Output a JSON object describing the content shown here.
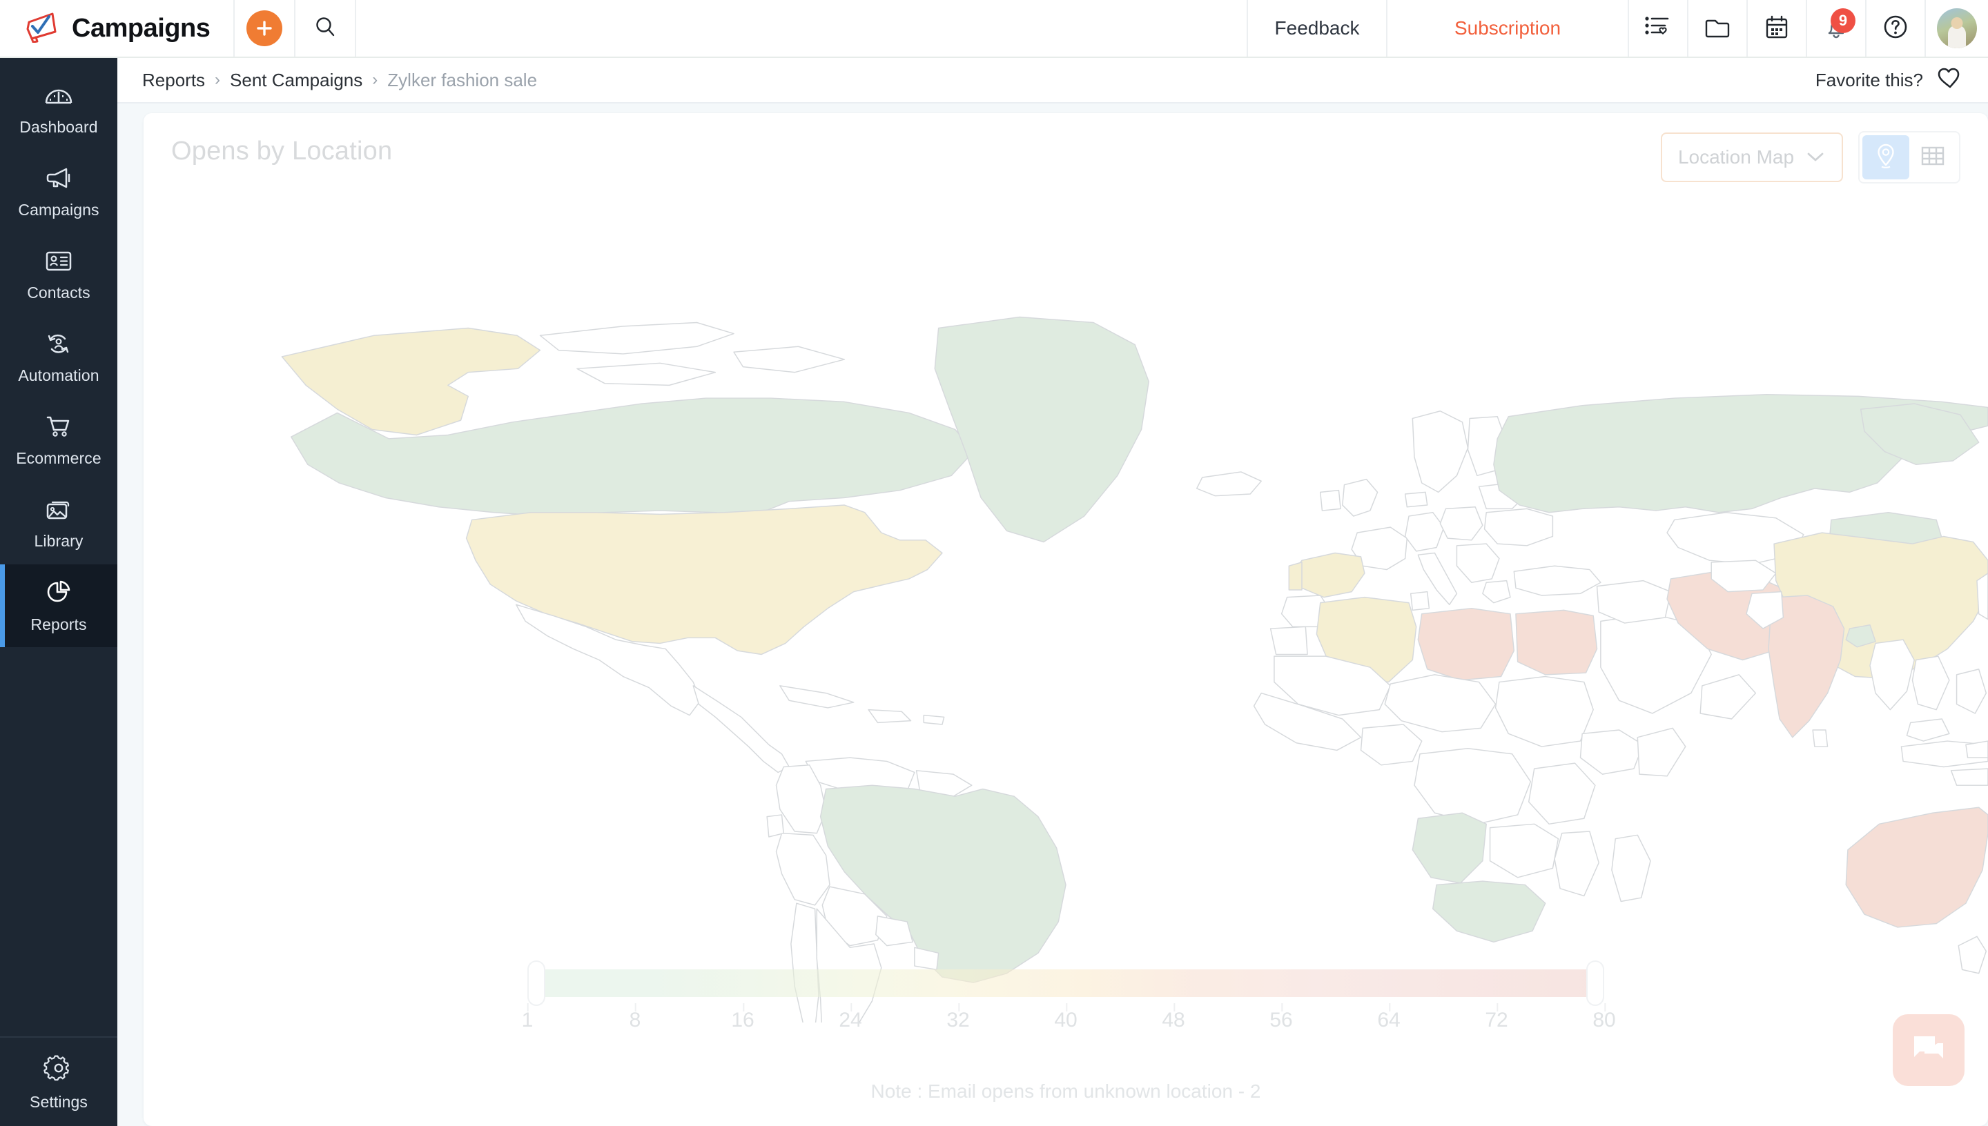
{
  "header": {
    "brand": "Campaigns",
    "logo_icon": "megaphone-logo-icon",
    "create_label": "+",
    "search_icon": "search-icon",
    "feedback_label": "Feedback",
    "subscription_label": "Subscription",
    "icons": [
      {
        "name": "list-heart-icon"
      },
      {
        "name": "folder-icon"
      },
      {
        "name": "calendar-icon"
      },
      {
        "name": "bell-icon",
        "badge": "9"
      },
      {
        "name": "help-icon"
      }
    ],
    "avatar_name": "user-avatar",
    "accent_orange": "#f07c33",
    "subscription_color": "#f2603c",
    "badge_color": "#ef5044"
  },
  "sidebar": {
    "items": [
      {
        "label": "Dashboard",
        "icon": "dashboard-gauge-icon",
        "active": false
      },
      {
        "label": "Campaigns",
        "icon": "megaphone-icon",
        "active": false
      },
      {
        "label": "Contacts",
        "icon": "contact-card-icon",
        "active": false
      },
      {
        "label": "Automation",
        "icon": "automation-cycle-icon",
        "active": false
      },
      {
        "label": "Ecommerce",
        "icon": "shopping-cart-icon",
        "active": false
      },
      {
        "label": "Library",
        "icon": "images-icon",
        "active": false
      },
      {
        "label": "Reports",
        "icon": "pie-chart-icon",
        "active": true
      }
    ],
    "footer": {
      "label": "Settings",
      "icon": "gear-icon"
    },
    "background": "#1d2733",
    "active_background": "#121a24",
    "active_marker": "#4a9ae8"
  },
  "breadcrumb": {
    "items": [
      "Reports",
      "Sent Campaigns",
      "Zylker fashion sale"
    ],
    "separator": "›",
    "favorite_label": "Favorite this?",
    "favorite_icon": "heart-icon"
  },
  "report": {
    "title": "Opens by Location",
    "view_select": {
      "value": "Location Map",
      "chevron_icon": "chevron-down-icon"
    },
    "view_toggle": [
      {
        "name": "map-view-toggle",
        "icon": "location-pin-icon",
        "active": true
      },
      {
        "name": "table-view-toggle",
        "icon": "table-grid-icon",
        "active": false
      }
    ],
    "note": "Note : Email opens from unknown location - 2"
  },
  "chart_data": {
    "type": "heatmap",
    "title": "Opens by Location",
    "subtitle": "",
    "legend_position": "bottom",
    "colorbar": {
      "ticks": [
        1,
        8,
        16,
        24,
        32,
        40,
        48,
        56,
        64,
        72,
        80
      ],
      "min": 1,
      "max": 80,
      "gradient": [
        "#dcefe0",
        "#eef2d6",
        "#f7f0d0",
        "#f9e9cb",
        "#f4d9d3",
        "#f0cfc9"
      ],
      "low_color": "#dcefe0",
      "mid_color": "#f7f0d0",
      "high_color": "#f0cfc9"
    },
    "unknown_location_opens": 2,
    "regions": [
      {
        "name": "Canada",
        "band": "low",
        "color": "#dfebe0"
      },
      {
        "name": "Greenland",
        "band": "low",
        "color": "#dfebe0"
      },
      {
        "name": "Alaska",
        "band": "mid",
        "color": "#f5efd2"
      },
      {
        "name": "United States",
        "band": "mid",
        "color": "#f7f0d4"
      },
      {
        "name": "Brazil",
        "band": "low",
        "color": "#dfebe0"
      },
      {
        "name": "Spain",
        "band": "mid",
        "color": "#f5efd2"
      },
      {
        "name": "Algeria",
        "band": "mid",
        "color": "#f5efd2"
      },
      {
        "name": "Libya",
        "band": "high",
        "color": "#f5ded6"
      },
      {
        "name": "Egypt",
        "band": "high",
        "color": "#f5ded6"
      },
      {
        "name": "Angola",
        "band": "low",
        "color": "#dfebe0"
      },
      {
        "name": "Russia",
        "band": "low",
        "color": "#dfebe0"
      },
      {
        "name": "Mongolia",
        "band": "low",
        "color": "#dfebe0"
      },
      {
        "name": "China",
        "band": "mid",
        "color": "#f5efd2"
      },
      {
        "name": "India",
        "band": "high",
        "color": "#f5ded6"
      },
      {
        "name": "Iran",
        "band": "high",
        "color": "#f5ded6"
      },
      {
        "name": "Australia",
        "band": "high",
        "color": "#f5ded6"
      },
      {
        "name": "Bangladesh",
        "band": "low",
        "color": "#dfebe0"
      },
      {
        "name": "South Africa",
        "band": "low",
        "color": "#dfebe0"
      }
    ]
  },
  "chat_widget": {
    "icon": "chat-bubble-icon",
    "color": "#fadfd8"
  }
}
